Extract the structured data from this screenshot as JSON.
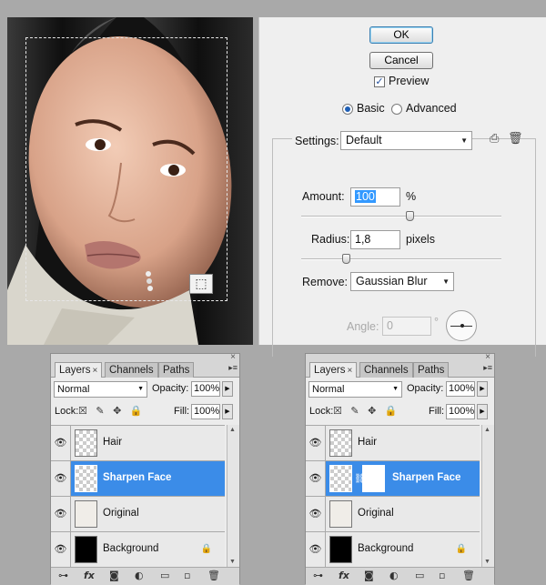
{
  "dialog": {
    "ok_label": "OK",
    "cancel_label": "Cancel",
    "preview_label": "Preview",
    "preview_checked": true,
    "mode_basic": "Basic",
    "mode_advanced": "Advanced",
    "mode_selected": "Basic",
    "settings_label": "Settings:",
    "settings_value": "Default",
    "amount_label": "Amount:",
    "amount_value": "100",
    "amount_unit": "%",
    "radius_label": "Radius:",
    "radius_value": "1,8",
    "radius_unit": "pixels",
    "remove_label": "Remove:",
    "remove_value": "Gaussian Blur",
    "angle_label": "Angle:",
    "angle_value": "0",
    "angle_unit": "°"
  },
  "layers_left": {
    "tabs": [
      "Layers",
      "Channels",
      "Paths"
    ],
    "blend_mode": "Normal",
    "opacity_label": "Opacity:",
    "opacity_value": "100%",
    "lock_label": "Lock:",
    "fill_label": "Fill:",
    "fill_value": "100%",
    "layers": [
      {
        "name": "Hair",
        "selected": false
      },
      {
        "name": "Sharpen Face",
        "selected": true
      },
      {
        "name": "Original",
        "selected": false
      },
      {
        "name": "Background",
        "selected": false,
        "locked": true
      }
    ]
  },
  "layers_right": {
    "tabs": [
      "Layers",
      "Channels",
      "Paths"
    ],
    "blend_mode": "Normal",
    "opacity_label": "Opacity:",
    "opacity_value": "100%",
    "lock_label": "Lock:",
    "fill_label": "Fill:",
    "fill_value": "100%",
    "layers": [
      {
        "name": "Hair",
        "selected": false
      },
      {
        "name": "Sharpen Face",
        "selected": true,
        "has_mask": true
      },
      {
        "name": "Original",
        "selected": false
      },
      {
        "name": "Background",
        "selected": false,
        "locked": true
      }
    ]
  },
  "icons": {
    "tab_close": "×",
    "panel_close": "×",
    "panel_menu": "▸≡",
    "dropdown": "▼",
    "stepper": "▶",
    "eye": "👁",
    "lock": "🔒",
    "save_preset": "⎙",
    "delete_preset": "🗑",
    "crop_preview": "⬚",
    "scroll_up": "▲",
    "scroll_down": "▼"
  },
  "colors": {
    "selection": "#3b8ce8",
    "text_selection": "#3399ff",
    "dialog_bg": "#efefef"
  }
}
